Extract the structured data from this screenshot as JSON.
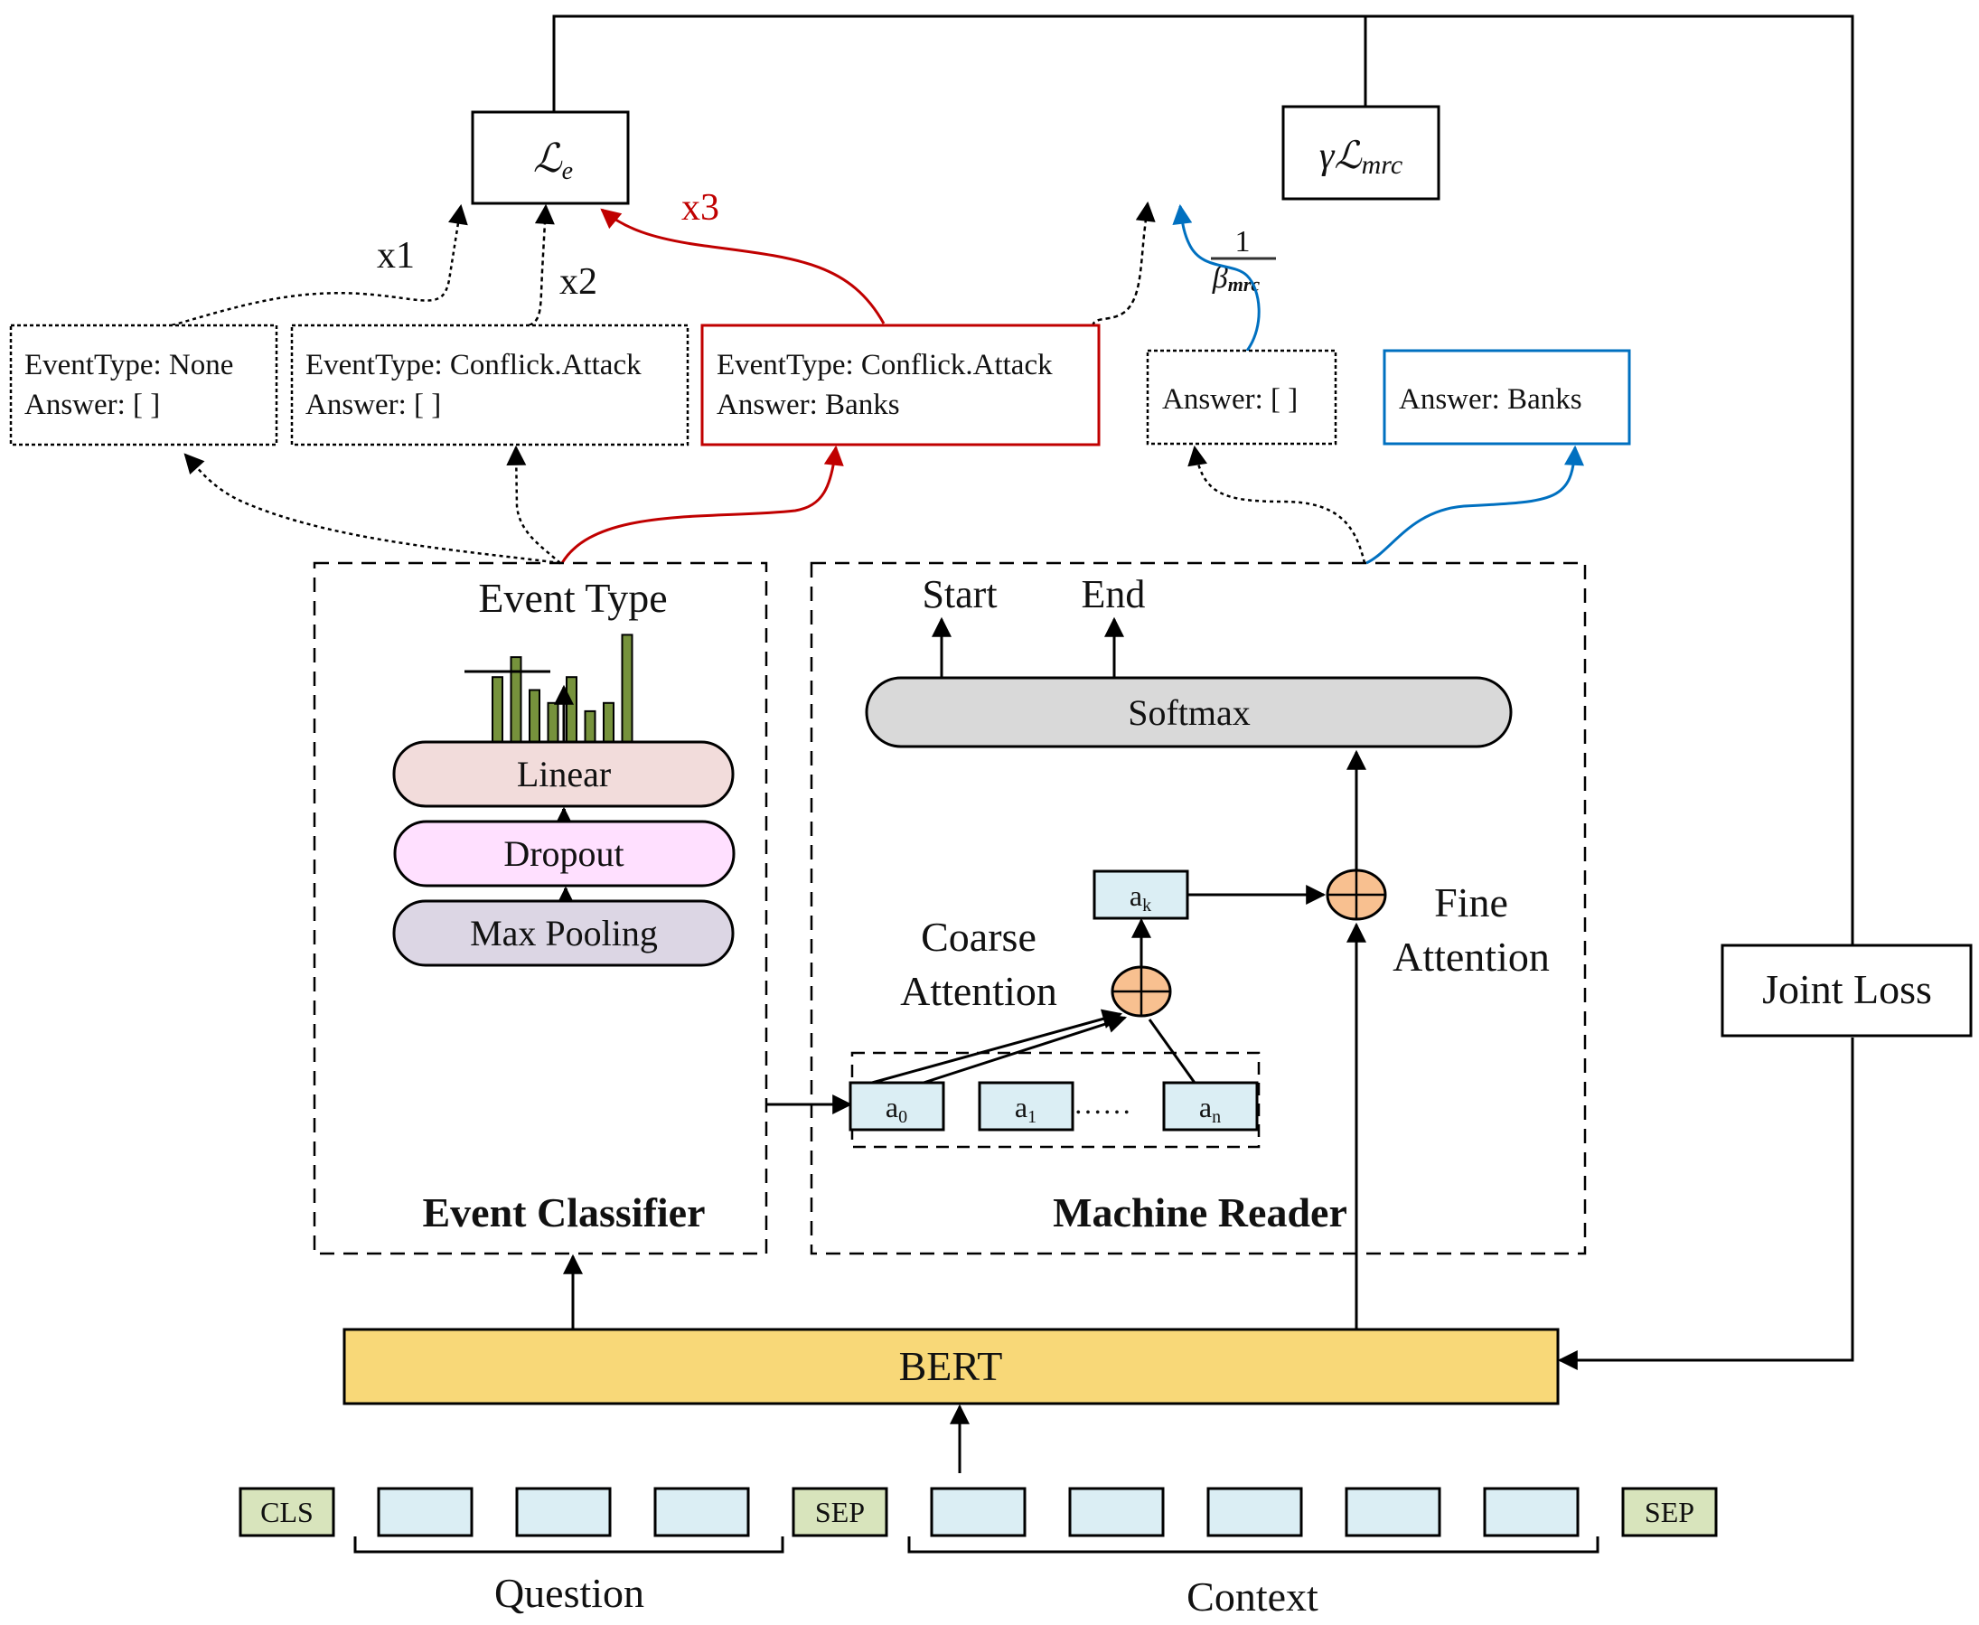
{
  "losses": {
    "event_loss": {
      "symbol": "ℒ",
      "subscript": "e"
    },
    "mrc_loss": {
      "prefix": "γ",
      "symbol": "ℒ",
      "subscript": "mrc"
    },
    "joint_loss": "Joint Loss",
    "beta_fraction": {
      "numerator": "1",
      "denominator": "β",
      "denominator_sub": "mrc"
    }
  },
  "weights": {
    "x1": "x1",
    "x2": "x2",
    "x3": "x3"
  },
  "colors": {
    "red": "#c00000",
    "blue": "#0070c0",
    "bert": "#f8d878",
    "token": "#dbeef4",
    "special_token": "#d8e4bc",
    "linear": "#f2dcdb",
    "dropout": "#ffe0ff",
    "maxpool": "#dcd6e4",
    "softmax": "#d9d9d9",
    "circle": "#f8c090",
    "bars": "#76923c"
  },
  "candidates": [
    {
      "line1": "EventType: None",
      "line2": "Answer: [ ]",
      "style": "dotted"
    },
    {
      "line1": "EventType: Conflick.Attack",
      "line2": "Answer: [ ]",
      "style": "dotted"
    },
    {
      "line1": "EventType: Conflick.Attack",
      "line2": "Answer: Banks",
      "style": "red"
    }
  ],
  "mrc_answers": [
    {
      "text": "Answer: [ ]",
      "style": "dotted"
    },
    {
      "text": "Answer: Banks",
      "style": "blue"
    }
  ],
  "event_classifier": {
    "title": "Event Classifier",
    "output_label": "Event Type",
    "layers": [
      "Linear",
      "Dropout",
      "Max Pooling"
    ],
    "bar_values": [
      0.56,
      0.73,
      0.45,
      0.34,
      0.56,
      0.27,
      0.34,
      0.92
    ]
  },
  "machine_reader": {
    "title": "Machine Reader",
    "outputs": [
      "Start",
      "End"
    ],
    "softmax": "Softmax",
    "coarse_attention": [
      "Coarse",
      "Attention"
    ],
    "fine_attention": [
      "Fine",
      "Attention"
    ],
    "ak": {
      "base": "a",
      "sub": "k"
    },
    "answers": [
      {
        "base": "a",
        "sub": "0"
      },
      {
        "base": "a",
        "sub": "1"
      },
      {
        "base": "a",
        "sub": "n"
      }
    ],
    "ellipsis": "……"
  },
  "encoder": {
    "label": "BERT"
  },
  "tokens": {
    "cls": "CLS",
    "sep": "SEP",
    "question_label": "Question",
    "context_label": "Context",
    "question_count": 3,
    "context_count": 5
  }
}
